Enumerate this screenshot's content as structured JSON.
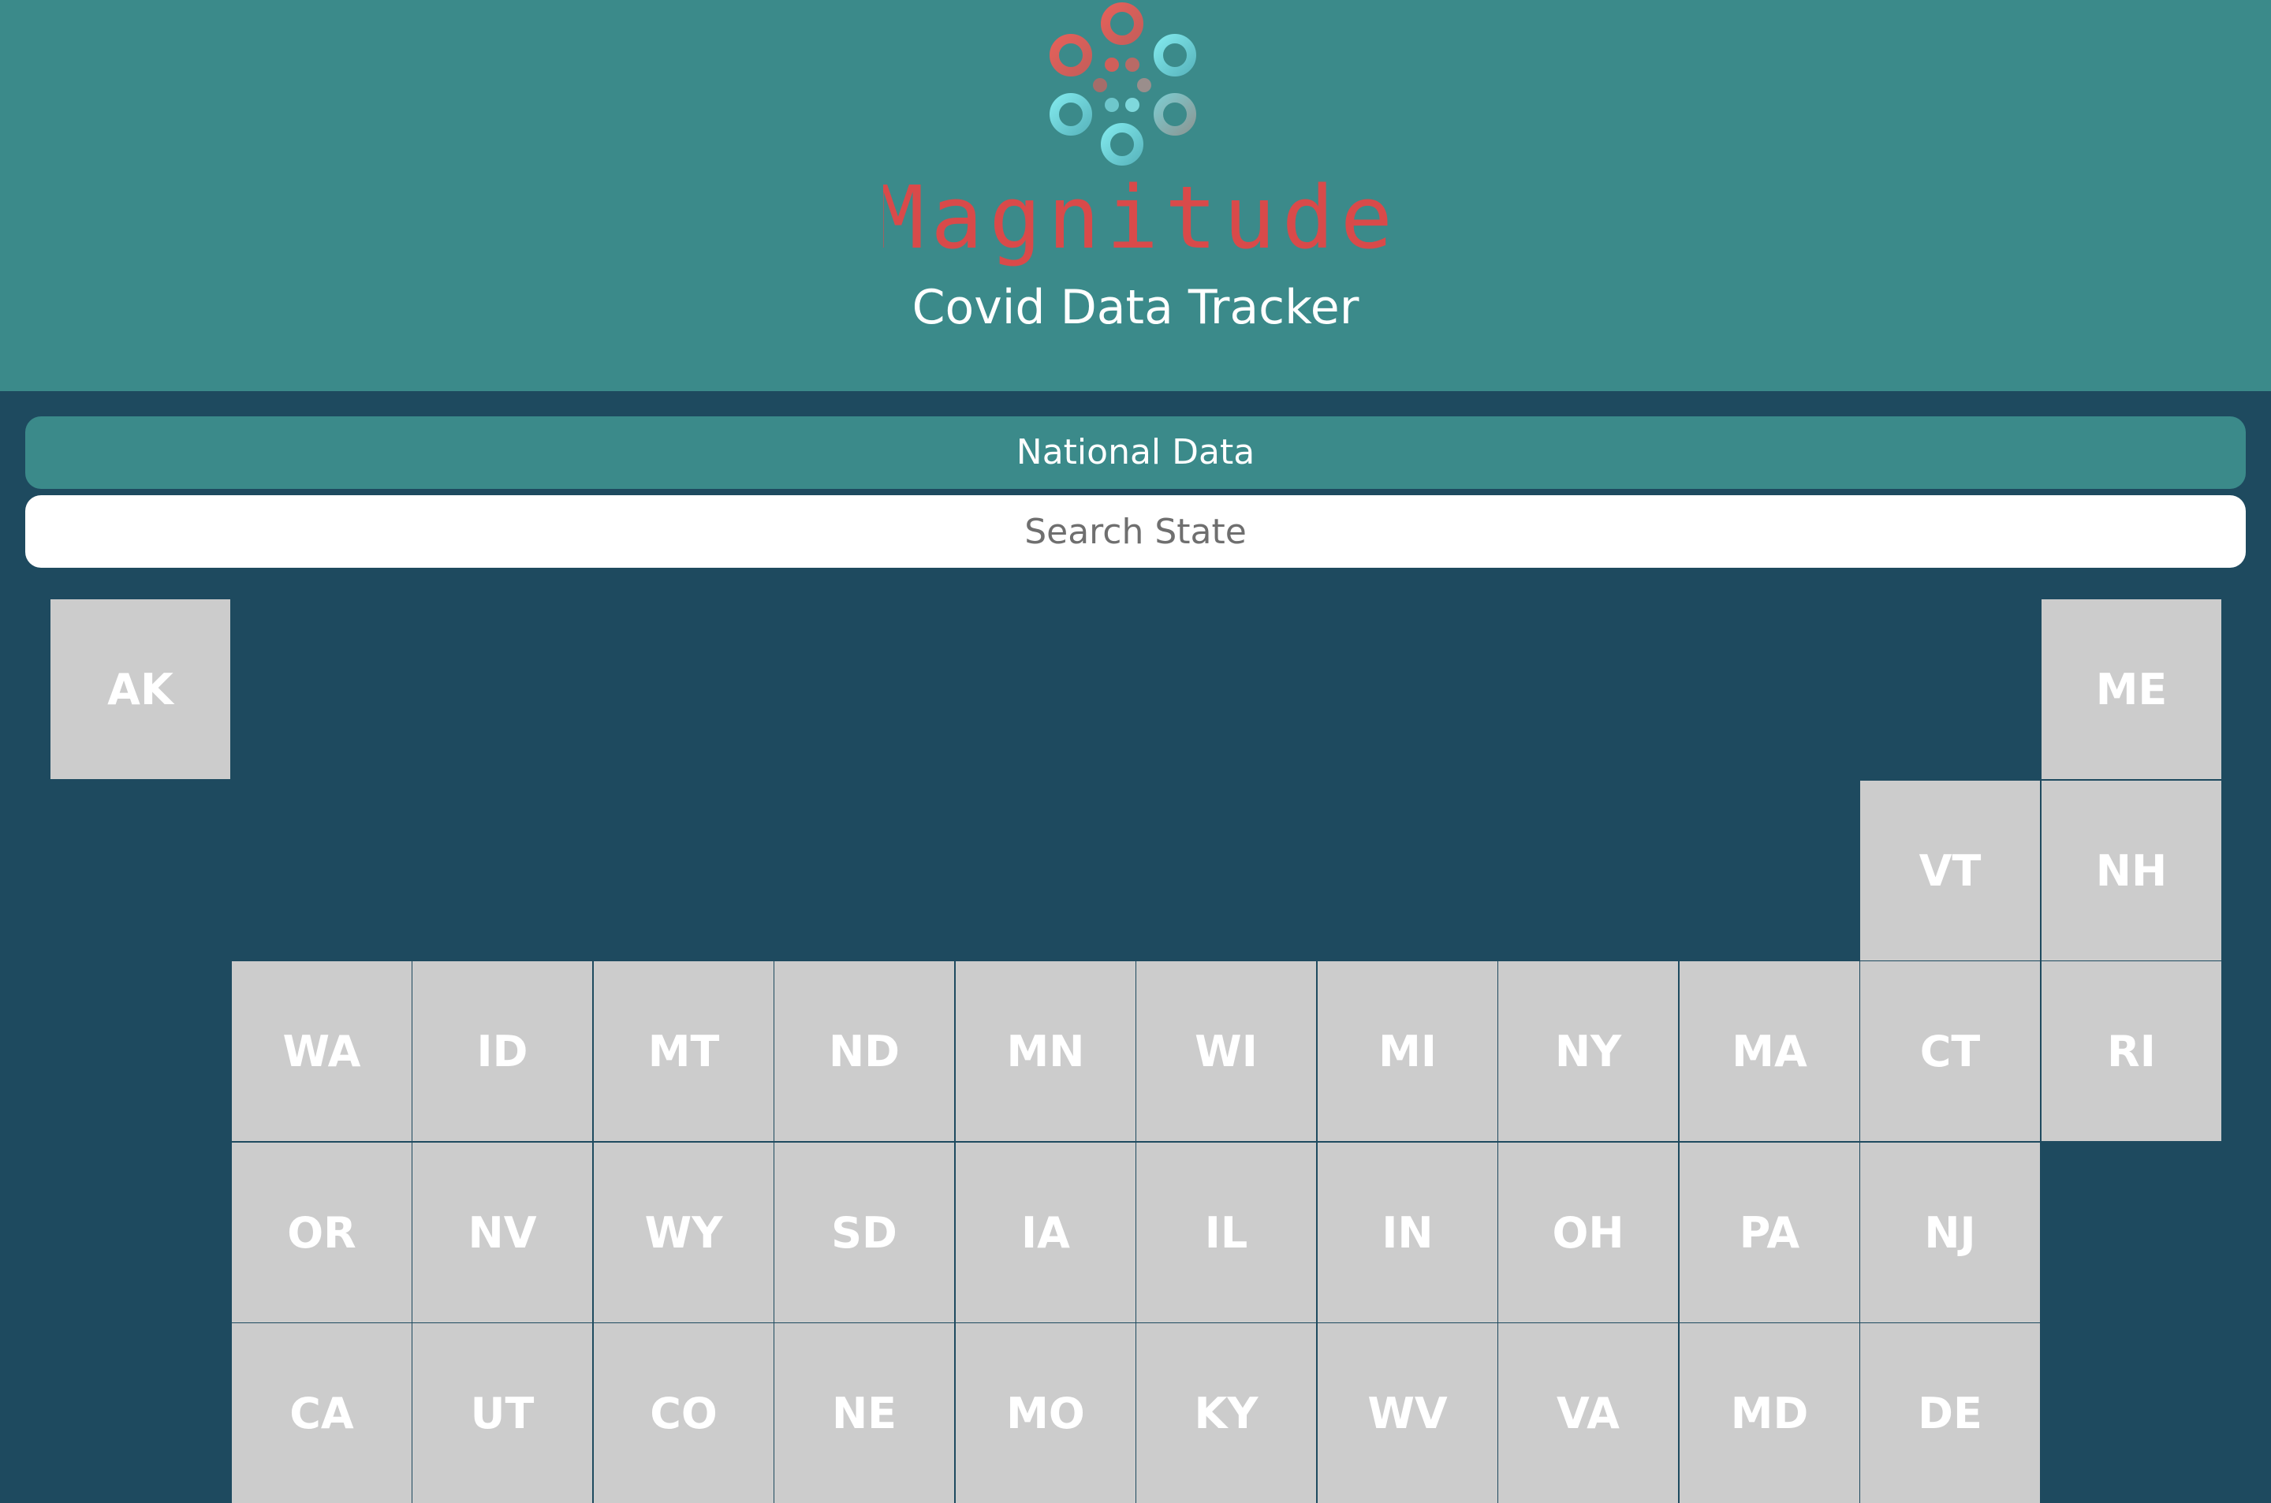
{
  "brand": {
    "name": "Magnitude",
    "subtitle": "Covid Data Tracker",
    "colors": {
      "header_bg": "#3b8a8a",
      "page_bg": "#1e4a5f",
      "wordmark": "#d94a4a",
      "tile": "#cccccc"
    }
  },
  "nav": {
    "national_label": "National Data",
    "search_placeholder": "Search State"
  },
  "states": [
    {
      "abbr": "AK",
      "row": 0,
      "col": 0
    },
    {
      "abbr": "ME",
      "row": 0,
      "col": 11
    },
    {
      "abbr": "VT",
      "row": 1,
      "col": 10
    },
    {
      "abbr": "NH",
      "row": 1,
      "col": 11
    },
    {
      "abbr": "WA",
      "row": 2,
      "col": 1
    },
    {
      "abbr": "ID",
      "row": 2,
      "col": 2
    },
    {
      "abbr": "MT",
      "row": 2,
      "col": 3
    },
    {
      "abbr": "ND",
      "row": 2,
      "col": 4
    },
    {
      "abbr": "MN",
      "row": 2,
      "col": 5
    },
    {
      "abbr": "WI",
      "row": 2,
      "col": 6
    },
    {
      "abbr": "MI",
      "row": 2,
      "col": 7
    },
    {
      "abbr": "NY",
      "row": 2,
      "col": 8
    },
    {
      "abbr": "MA",
      "row": 2,
      "col": 9
    },
    {
      "abbr": "CT",
      "row": 2,
      "col": 10
    },
    {
      "abbr": "RI",
      "row": 2,
      "col": 11
    },
    {
      "abbr": "OR",
      "row": 3,
      "col": 1
    },
    {
      "abbr": "NV",
      "row": 3,
      "col": 2
    },
    {
      "abbr": "WY",
      "row": 3,
      "col": 3
    },
    {
      "abbr": "SD",
      "row": 3,
      "col": 4
    },
    {
      "abbr": "IA",
      "row": 3,
      "col": 5
    },
    {
      "abbr": "IL",
      "row": 3,
      "col": 6
    },
    {
      "abbr": "IN",
      "row": 3,
      "col": 7
    },
    {
      "abbr": "OH",
      "row": 3,
      "col": 8
    },
    {
      "abbr": "PA",
      "row": 3,
      "col": 9
    },
    {
      "abbr": "NJ",
      "row": 3,
      "col": 10
    },
    {
      "abbr": "CA",
      "row": 4,
      "col": 1
    },
    {
      "abbr": "UT",
      "row": 4,
      "col": 2
    },
    {
      "abbr": "CO",
      "row": 4,
      "col": 3
    },
    {
      "abbr": "NE",
      "row": 4,
      "col": 4
    },
    {
      "abbr": "MO",
      "row": 4,
      "col": 5
    },
    {
      "abbr": "KY",
      "row": 4,
      "col": 6
    },
    {
      "abbr": "WV",
      "row": 4,
      "col": 7
    },
    {
      "abbr": "VA",
      "row": 4,
      "col": 8
    },
    {
      "abbr": "MD",
      "row": 4,
      "col": 9
    },
    {
      "abbr": "DE",
      "row": 4,
      "col": 10
    }
  ]
}
